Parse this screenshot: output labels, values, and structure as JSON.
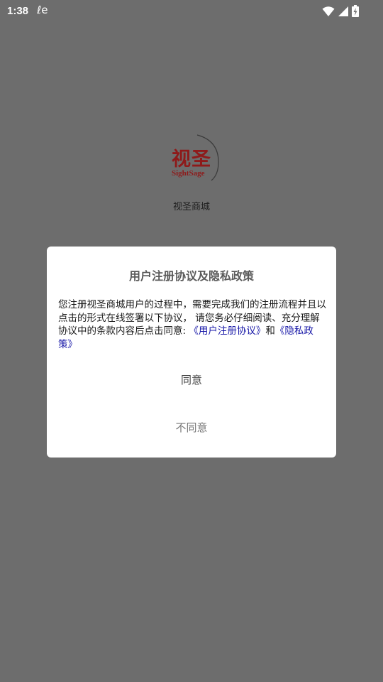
{
  "status_bar": {
    "time": "1:38",
    "sim_glyph": "ℓe",
    "icons": [
      "wifi-icon",
      "signal-icon",
      "battery-charging-icon"
    ]
  },
  "app": {
    "logo_text": "视圣",
    "logo_subtext": "SightSage",
    "name": "视圣商城"
  },
  "dialog": {
    "title": "用户注册协议及隐私政策",
    "body_text": "您注册视圣商城用户的过程中，需要完成我们的注册流程并且以点击的形式在线签署以下协议， 请您务必仔细阅读、充分理解协议中的条款内容后点击同意: ",
    "link_user_agreement": "《用户注册协议》",
    "conjunction": "和",
    "link_privacy_policy": "《隐私政策》",
    "agree_label": "同意",
    "disagree_label": "不同意"
  },
  "colors": {
    "overlay_background": "#6d6d6d",
    "dialog_background": "#ffffff",
    "link": "#1a1aa8",
    "logo_red": "#9b1b1b"
  }
}
